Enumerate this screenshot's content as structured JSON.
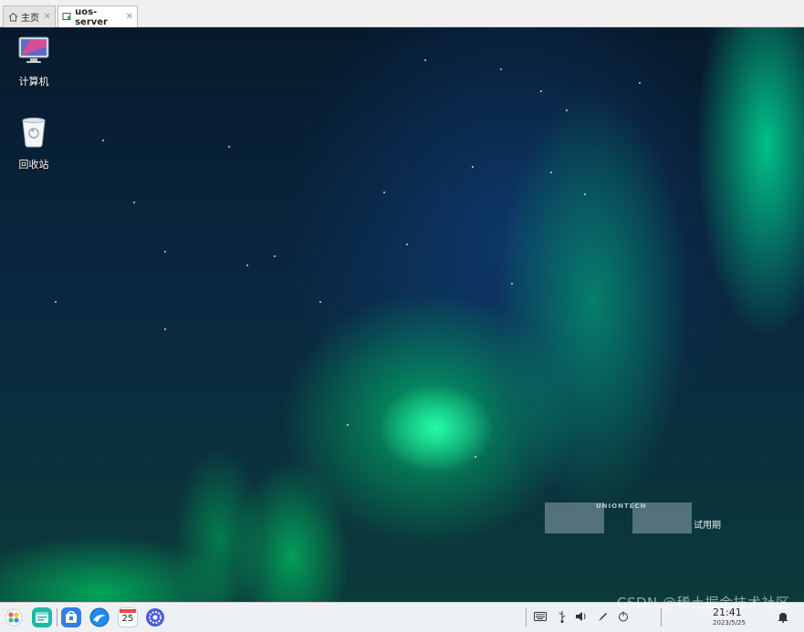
{
  "tabs": [
    {
      "label": "主页",
      "icon": "home-icon",
      "active": false
    },
    {
      "label": "uos-server",
      "icon": "vm-icon",
      "active": true
    }
  ],
  "desktop": {
    "icons": [
      {
        "label": "计算机",
        "icon": "computer-icon"
      },
      {
        "label": "回收站",
        "icon": "trash-icon"
      }
    ],
    "watermark": {
      "brand": "UNIONTECH",
      "trial": "试用期"
    }
  },
  "taskbar": {
    "apps": [
      "launcher-icon",
      "file-manager-icon",
      "app-store-icon",
      "browser-icon",
      "calendar-icon",
      "settings-icon"
    ],
    "calendar_day": "25",
    "tray": [
      "keyboard-icon",
      "usb-icon",
      "volume-icon",
      "pen-icon",
      "power-icon",
      "notification-icon"
    ],
    "time": "21:41",
    "date": "2023/5/25"
  },
  "overlay": {
    "source_watermark": "CSDN @稀土掘金技术社区"
  },
  "colors": {
    "accent_green": "#00e08a",
    "taskbar_bg": "#eef1f4",
    "sky_dark": "#071a2c"
  }
}
